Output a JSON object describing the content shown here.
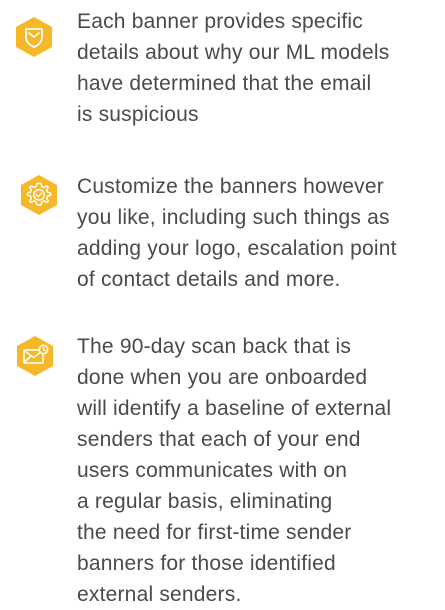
{
  "theme": {
    "accent": "#f5b829",
    "text": "#4a4a4a",
    "icon_stroke": "#ffffff"
  },
  "features": [
    {
      "icon": "shield-icon",
      "lines": [
        "Each banner provides specific",
        "details about why our ML models",
        "have determined that the email",
        "is suspicious"
      ]
    },
    {
      "icon": "gear-settings-icon",
      "lines": [
        "Customize the banners however",
        "you like, including such things as",
        "adding your logo, escalation point",
        "of contact details and more."
      ]
    },
    {
      "icon": "email-clock-icon",
      "lines": [
        "The 90-day scan back that is",
        "done when you are onboarded",
        "will identify a baseline of external",
        "senders that each of your end",
        "users communicates with on",
        "a regular basis, eliminating",
        "the need for first-time sender",
        "banners for those identified",
        "external senders."
      ]
    }
  ]
}
